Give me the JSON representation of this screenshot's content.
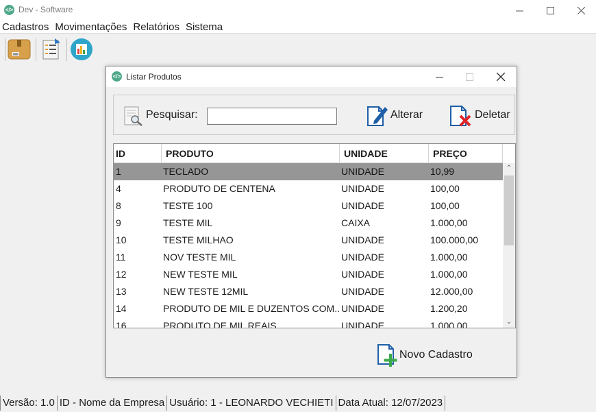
{
  "window": {
    "title": "Dev - Software",
    "icon_text": "</>"
  },
  "menu": [
    "Cadastros",
    "Movimentações",
    "Relatórios",
    "Sistema"
  ],
  "toolbar": {
    "buttons": [
      "box-icon",
      "document-list-icon",
      "bar-chart-icon"
    ]
  },
  "frame": {
    "title": "Listar Produtos",
    "search_label": "Pesquisar:",
    "search_value": "",
    "alter_label": "Alterar",
    "delete_label": "Deletar",
    "new_label": "Novo Cadastro"
  },
  "table": {
    "columns": [
      "ID",
      "PRODUTO",
      "UNIDADE",
      "PREÇO"
    ],
    "rows": [
      [
        "1",
        "TECLADO",
        "UNIDADE",
        "10,99"
      ],
      [
        "4",
        "PRODUTO DE CENTENA",
        "UNIDADE",
        "100,00"
      ],
      [
        "8",
        "TESTE 100",
        "UNIDADE",
        "100,00"
      ],
      [
        "9",
        "TESTE MIL",
        "CAIXA",
        "1.000,00"
      ],
      [
        "10",
        "TESTE MILHAO",
        "UNIDADE",
        "100.000,00"
      ],
      [
        "11",
        "NOV TESTE MIL",
        "UNIDADE",
        "1.000,00"
      ],
      [
        "12",
        "NEW TESTE MIL",
        "UNIDADE",
        "1.000,00"
      ],
      [
        "13",
        "NEW TESTE 12MIL",
        "UNIDADE",
        "12.000,00"
      ],
      [
        "14",
        "PRODUTO DE MIL E DUZENTOS COM...",
        "UNIDADE",
        "1.200,20"
      ],
      [
        "16",
        "PRODUTO DE MIL REAIS",
        "UNIDADE",
        "1.000,00"
      ]
    ],
    "selected_row": 0
  },
  "status": {
    "version": "Versão: 1.0",
    "company": "ID - Nome da Empresa",
    "user": "Usuário: 1 - LEONARDO VECHIETI",
    "date": "Data Atual:  12/07/2023"
  },
  "colors": {
    "selected_row": "#969696",
    "accent_blue": "#1f5fa8",
    "delete_red": "#e0242a",
    "add_green": "#3caa4a"
  }
}
